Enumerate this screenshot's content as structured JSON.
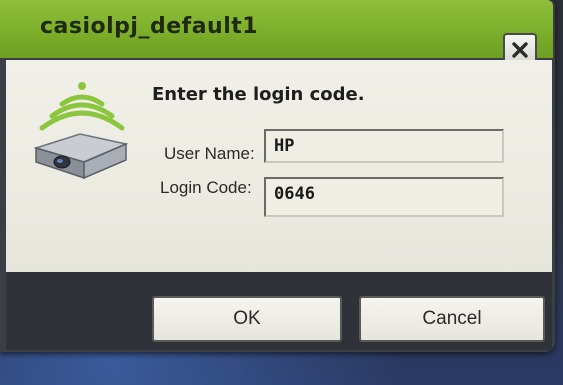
{
  "window": {
    "title": "casiolpj_default1"
  },
  "dialog": {
    "heading": "Enter the login code.",
    "user_name_label": "User Name:",
    "user_name_value": "HP",
    "login_code_label": "Login Code:",
    "login_code_value": "0646"
  },
  "buttons": {
    "ok_label": "OK",
    "cancel_label": "Cancel"
  },
  "icons": {
    "projector": "wireless-projector-icon",
    "close": "close-icon"
  },
  "colors": {
    "titlebar": "#7fb22d",
    "panel": "#eeede4",
    "wireless_waves": "#8cc63f"
  }
}
